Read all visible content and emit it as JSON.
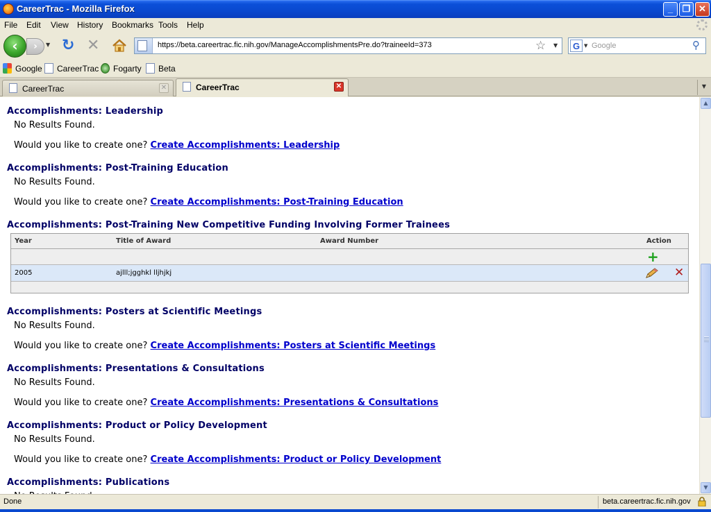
{
  "window": {
    "title": "CareerTrac - Mozilla Firefox",
    "minimize": "_",
    "maximize": "❐",
    "close": "✕"
  },
  "menu": {
    "items": [
      "File",
      "Edit",
      "View",
      "History",
      "Bookmarks",
      "Tools",
      "Help"
    ]
  },
  "nav": {
    "url": "https://beta.careertrac.fic.nih.gov/ManageAccomplishmentsPre.do?traineeId=373",
    "search_placeholder": "Google",
    "search_engine_letter": "G"
  },
  "bookmarks": {
    "items": [
      "Google",
      "CareerTrac",
      "Fogarty",
      "Beta"
    ]
  },
  "tabs": [
    {
      "label": "CareerTrac",
      "active": false
    },
    {
      "label": "CareerTrac",
      "active": true
    }
  ],
  "page": {
    "prompt_text": "Would you like to create one?",
    "no_results": "No Results Found.",
    "sections": [
      {
        "title": "Accomplishments: Leadership",
        "link": "Create Accomplishments: Leadership"
      },
      {
        "title": "Accomplishments: Post-Training Education",
        "link": "Create Accomplishments: Post-Training Education"
      },
      {
        "title": "Accomplishments: Post-Training New Competitive Funding Involving Former Trainees"
      },
      {
        "title": "Accomplishments: Posters at Scientific Meetings",
        "link": "Create Accomplishments: Posters at Scientific Meetings"
      },
      {
        "title": "Accomplishments: Presentations & Consultations",
        "link": "Create Accomplishments: Presentations & Consultations"
      },
      {
        "title": "Accomplishments: Product or Policy Development",
        "link": "Create Accomplishments: Product or Policy Development"
      },
      {
        "title": "Accomplishments: Publications"
      }
    ],
    "funding_table": {
      "columns": [
        "Year",
        "Title of Award",
        "Award Number",
        "Action"
      ],
      "rows": [
        {
          "year": "2005",
          "title": "ajlll;jgghkl lljhjkj",
          "award_number": ""
        }
      ]
    }
  },
  "status": {
    "text": "Done",
    "host": "beta.careertrac.fic.nih.gov"
  },
  "colors": {
    "section_title": "#000066",
    "link": "#0000cc",
    "row_highlight": "#dbe8f8",
    "add_icon": "#1ea21e",
    "delete_icon": "#b01d1d"
  }
}
